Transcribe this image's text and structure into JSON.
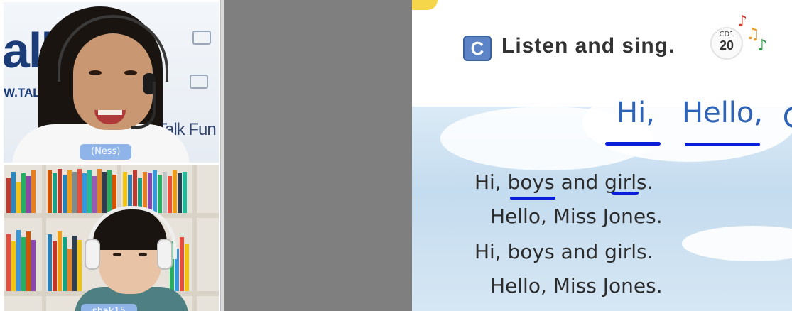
{
  "video_panel": {
    "teacher": {
      "name_tag": "(Ness)",
      "backdrop_brand": "alk",
      "backdrop_url": "W.TALK",
      "backdrop_small": "Talk Fun"
    },
    "student": {
      "name_tag": "shak15"
    }
  },
  "slide": {
    "section_badge": "C",
    "heading": "Listen and sing.",
    "cd_label": "CD1",
    "cd_track": "20",
    "title_words": [
      "Hi,",
      "Hello,"
    ],
    "lyrics": [
      "Hi, boys and girls.",
      "Hello, Miss Jones.",
      "Hi, boys and girls.",
      "Hello, Miss Jones."
    ],
    "annotation_color": "#0a1edc",
    "note_colors": [
      "#d0392b",
      "#e39a2d",
      "#2f9a4a"
    ]
  }
}
